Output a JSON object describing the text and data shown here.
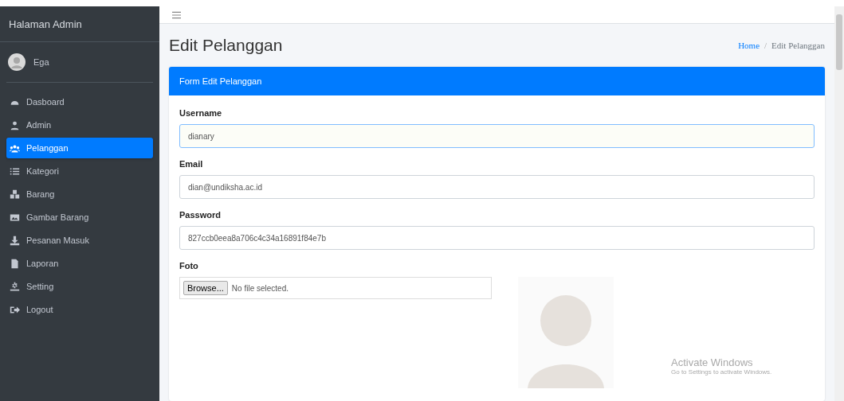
{
  "sidebar": {
    "brand": "Halaman Admin",
    "user": {
      "name": "Ega"
    },
    "menu": [
      {
        "label": "Dasboard",
        "selected": false
      },
      {
        "label": "Admin",
        "selected": false
      },
      {
        "label": "Pelanggan",
        "selected": true
      },
      {
        "label": "Kategori",
        "selected": false
      },
      {
        "label": "Barang",
        "selected": false
      },
      {
        "label": "Gambar Barang",
        "selected": false
      },
      {
        "label": "Pesanan Masuk",
        "selected": false
      },
      {
        "label": "Laporan",
        "selected": false
      },
      {
        "label": "Setting",
        "selected": false
      },
      {
        "label": "Logout",
        "selected": false
      }
    ]
  },
  "page": {
    "title": "Edit Pelanggan",
    "breadcrumb_separator": "/",
    "breadcrumb": [
      {
        "label": "Home",
        "kind": "link"
      },
      {
        "label": "Edit Pelanggan",
        "kind": "current"
      }
    ]
  },
  "card": {
    "title": "Form Edit Pelanggan",
    "fields": [
      {
        "label": "Username",
        "kind": "text",
        "value": "dianary",
        "focused": true
      },
      {
        "label": "Email",
        "kind": "text",
        "value": "dian@undiksha.ac.id",
        "focused": false
      },
      {
        "label": "Password",
        "kind": "text",
        "value": "827ccb0eea8a706c4c34a16891f84e7b",
        "focused": false
      },
      {
        "label": "Foto",
        "kind": "file",
        "button": "Browse...",
        "status": "No file selected."
      }
    ]
  },
  "os_notice": {
    "title": "Activate Windows",
    "subtitle": "Go to Settings to activate Windows."
  }
}
